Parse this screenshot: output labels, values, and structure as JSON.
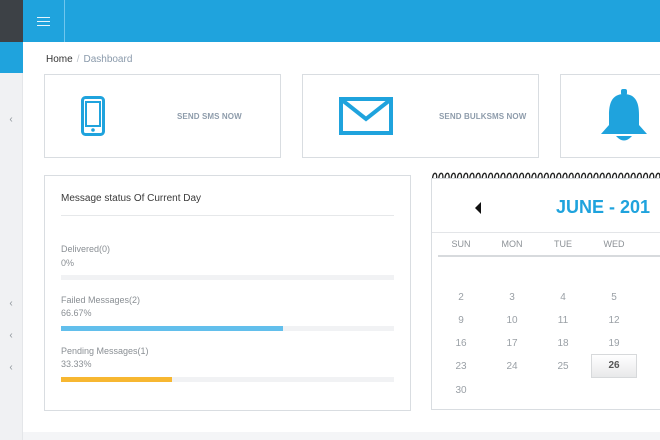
{
  "breadcrumb": {
    "home": "Home",
    "separator": "/",
    "current": "Dashboard"
  },
  "actions": [
    {
      "label": "SEND SMS NOW",
      "icon": "mobile-phone-icon"
    },
    {
      "label": "SEND BULKSMS NOW",
      "icon": "envelope-icon"
    },
    {
      "label": "",
      "icon": "bell-icon"
    }
  ],
  "status": {
    "title": "Message status Of Current Day",
    "items": [
      {
        "name": "Delivered(0)",
        "percent_text": "0%",
        "percent": 0,
        "color": "#5bc0eb"
      },
      {
        "name": "Failed Messages(2)",
        "percent_text": "66.67%",
        "percent": 66.67,
        "color": "#62bfec"
      },
      {
        "name": "Pending Messages(1)",
        "percent_text": "33.33%",
        "percent": 33.33,
        "color": "#f7b731"
      }
    ]
  },
  "calendar": {
    "month_label": "JUNE - 201",
    "weekdays": [
      "SUN",
      "MON",
      "TUE",
      "WED",
      "T"
    ],
    "rows": [
      [
        "2",
        "3",
        "4",
        "5",
        ""
      ],
      [
        "9",
        "10",
        "11",
        "12",
        ""
      ],
      [
        "16",
        "17",
        "18",
        "19",
        ""
      ],
      [
        "23",
        "24",
        "25",
        "26",
        ""
      ],
      [
        "30",
        "",
        "",
        "",
        ""
      ]
    ],
    "today": "26"
  },
  "sidebar": {
    "chevron": "‹"
  },
  "colors": {
    "accent": "#1fa3dd",
    "sidebar_dark": "#3d4146"
  }
}
